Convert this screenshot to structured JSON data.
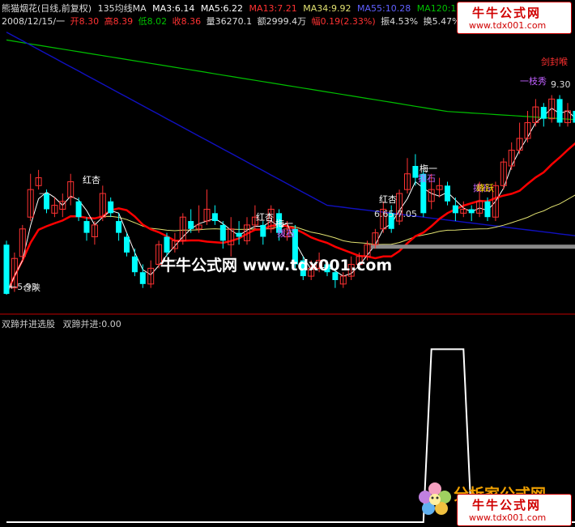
{
  "header": {
    "stock_name": "熊猫烟花(日线,前复权)",
    "ma_label": "135均线MA",
    "ma3": "MA3:6.14",
    "ma5": "MA5:6.22",
    "ma13": "MA13:7.21",
    "ma34": "MA34:9.92",
    "ma55": "MA55:10.28",
    "ma120": "MA120:10.28",
    "arrow_down": "↓"
  },
  "header2": {
    "date": "2008/12/15/一",
    "open": "开8.30",
    "high": "高8.39",
    "low": "低8.02",
    "close": "收8.36",
    "volume": "量36270.1",
    "amount": "额2999.4万",
    "change": "幅0.19(2.33%)",
    "amplitude": "振4.53%",
    "turnover": "换5.47%",
    "float": "流通"
  },
  "sub_panel": {
    "title": "双蹄并进选股",
    "value": "双蹄并进:0.00"
  },
  "watermark": "牛牛公式网 www.tdx001.com",
  "brand": {
    "name": "牛牛公式网",
    "url": "www.tdx001.com"
  },
  "brand_bottom": {
    "name": "牛牛公式网",
    "url": "www.tdx001.com",
    "under": "分析家公式网"
  },
  "annotations": {
    "jianfenghou": "剑封喉",
    "yizhixiu": "一枝秀",
    "price_930": "9.30",
    "hongxing1": "红杏",
    "hongxing2": "红杏",
    "hongxing3": "红杏",
    "meiyi1": "梅一",
    "meiyi2": "梅一",
    "jihua1": "拨石",
    "jihua2": "拨石",
    "jihua3": "拨石",
    "range_label": "6.65-7.05",
    "lowest": "←5.93",
    "yinchang": "仓陕",
    "dash": "—",
    "dash2": "—",
    "huoyao": "峰跃"
  },
  "colors": {
    "up": "#ff3232",
    "down": "#00ffff",
    "ma3": "#ffffff",
    "ma13": "#ff0000",
    "ma34": "#e0e070",
    "ma55": "#1010c0",
    "ma120": "#00c000",
    "sub_line": "#ffffff",
    "divider": "#c00000"
  },
  "chart_data": {
    "type": "candlestick",
    "candles": [
      {
        "o": 7.2,
        "c": 5.95,
        "h": 7.3,
        "l": 5.93
      },
      {
        "o": 6.1,
        "c": 6.85,
        "h": 7.0,
        "l": 6.0
      },
      {
        "o": 6.9,
        "c": 7.6,
        "h": 7.7,
        "l": 6.8
      },
      {
        "o": 7.9,
        "c": 8.6,
        "h": 9.0,
        "l": 7.8
      },
      {
        "o": 8.7,
        "c": 8.9,
        "h": 9.1,
        "l": 8.6
      },
      {
        "o": 8.5,
        "c": 8.1,
        "h": 8.6,
        "l": 8.0
      },
      {
        "o": 8.0,
        "c": 8.2,
        "h": 8.4,
        "l": 7.9
      },
      {
        "o": 8.1,
        "c": 8.3,
        "h": 8.5,
        "l": 7.9
      },
      {
        "o": 8.4,
        "c": 8.8,
        "h": 9.0,
        "l": 8.2
      },
      {
        "o": 8.3,
        "c": 7.9,
        "h": 8.4,
        "l": 7.8
      },
      {
        "o": 7.8,
        "c": 7.5,
        "h": 7.9,
        "l": 7.3
      },
      {
        "o": 7.4,
        "c": 7.7,
        "h": 7.8,
        "l": 7.2
      },
      {
        "o": 7.9,
        "c": 8.5,
        "h": 8.7,
        "l": 7.8
      },
      {
        "o": 8.3,
        "c": 8.0,
        "h": 8.4,
        "l": 7.9
      },
      {
        "o": 7.8,
        "c": 7.5,
        "h": 8.0,
        "l": 7.3
      },
      {
        "o": 7.4,
        "c": 7.0,
        "h": 7.5,
        "l": 6.9
      },
      {
        "o": 6.9,
        "c": 6.5,
        "h": 7.1,
        "l": 6.4
      },
      {
        "o": 6.5,
        "c": 6.2,
        "h": 6.7,
        "l": 6.1
      },
      {
        "o": 6.2,
        "c": 6.6,
        "h": 6.8,
        "l": 6.1
      },
      {
        "o": 6.7,
        "c": 7.2,
        "h": 7.3,
        "l": 6.6
      },
      {
        "o": 7.4,
        "c": 7.0,
        "h": 7.5,
        "l": 6.9
      },
      {
        "o": 7.1,
        "c": 7.3,
        "h": 7.5,
        "l": 7.0
      },
      {
        "o": 7.3,
        "c": 7.9,
        "h": 8.0,
        "l": 7.2
      },
      {
        "o": 7.8,
        "c": 7.6,
        "h": 8.1,
        "l": 7.5
      },
      {
        "o": 7.6,
        "c": 7.7,
        "h": 8.2,
        "l": 7.5
      },
      {
        "o": 7.8,
        "c": 8.1,
        "h": 8.6,
        "l": 7.7
      },
      {
        "o": 8.0,
        "c": 7.8,
        "h": 8.2,
        "l": 7.7
      },
      {
        "o": 7.7,
        "c": 7.3,
        "h": 7.8,
        "l": 7.1
      },
      {
        "o": 7.2,
        "c": 7.6,
        "h": 7.9,
        "l": 6.9
      },
      {
        "o": 7.5,
        "c": 7.4,
        "h": 7.8,
        "l": 7.2
      },
      {
        "o": 7.3,
        "c": 7.7,
        "h": 7.9,
        "l": 7.2
      },
      {
        "o": 7.7,
        "c": 7.9,
        "h": 8.2,
        "l": 7.6
      },
      {
        "o": 7.7,
        "c": 7.4,
        "h": 7.8,
        "l": 7.2
      },
      {
        "o": 7.6,
        "c": 8.1,
        "h": 8.2,
        "l": 7.5
      },
      {
        "o": 8.0,
        "c": 7.5,
        "h": 8.1,
        "l": 7.3
      },
      {
        "o": 7.4,
        "c": 7.6,
        "h": 7.8,
        "l": 7.3
      },
      {
        "o": 7.6,
        "c": 6.7,
        "h": 7.7,
        "l": 6.6
      },
      {
        "o": 6.8,
        "c": 6.4,
        "h": 6.9,
        "l": 6.3
      },
      {
        "o": 6.4,
        "c": 6.6,
        "h": 6.8,
        "l": 6.3
      },
      {
        "o": 6.6,
        "c": 6.8,
        "h": 7.0,
        "l": 6.5
      },
      {
        "o": 6.7,
        "c": 6.5,
        "h": 6.8,
        "l": 6.4
      },
      {
        "o": 6.5,
        "c": 6.3,
        "h": 6.6,
        "l": 6.1
      },
      {
        "o": 6.2,
        "c": 6.4,
        "h": 6.5,
        "l": 6.1
      },
      {
        "o": 6.4,
        "c": 6.7,
        "h": 6.9,
        "l": 6.3
      },
      {
        "o": 6.7,
        "c": 6.9,
        "h": 7.0,
        "l": 6.6
      },
      {
        "o": 6.9,
        "c": 7.2,
        "h": 7.3,
        "l": 6.8
      },
      {
        "o": 7.2,
        "c": 7.5,
        "h": 7.6,
        "l": 7.1
      },
      {
        "o": 7.6,
        "c": 8.1,
        "h": 8.3,
        "l": 7.5
      },
      {
        "o": 8.0,
        "c": 7.6,
        "h": 8.2,
        "l": 7.5
      },
      {
        "o": 7.8,
        "c": 8.5,
        "h": 8.6,
        "l": 7.7
      },
      {
        "o": 8.6,
        "c": 9.0,
        "h": 9.4,
        "l": 8.5
      },
      {
        "o": 9.2,
        "c": 8.9,
        "h": 9.5,
        "l": 8.7
      },
      {
        "o": 9.0,
        "c": 8.0,
        "h": 9.1,
        "l": 7.9
      },
      {
        "o": 8.3,
        "c": 8.6,
        "h": 9.0,
        "l": 8.1
      },
      {
        "o": 8.6,
        "c": 8.7,
        "h": 8.9,
        "l": 8.4
      },
      {
        "o": 8.7,
        "c": 8.3,
        "h": 8.8,
        "l": 8.2
      },
      {
        "o": 8.2,
        "c": 8.0,
        "h": 8.4,
        "l": 7.8
      },
      {
        "o": 8.0,
        "c": 8.1,
        "h": 8.3,
        "l": 7.9
      },
      {
        "o": 8.1,
        "c": 8.0,
        "h": 8.2,
        "l": 7.8
      },
      {
        "o": 8.0,
        "c": 8.3,
        "h": 8.8,
        "l": 7.9
      },
      {
        "o": 8.3,
        "c": 7.9,
        "h": 8.4,
        "l": 7.8
      },
      {
        "o": 7.9,
        "c": 8.7,
        "h": 8.8,
        "l": 7.8
      },
      {
        "o": 8.7,
        "c": 9.3,
        "h": 9.4,
        "l": 8.6
      },
      {
        "o": 9.2,
        "c": 9.6,
        "h": 9.8,
        "l": 9.1
      },
      {
        "o": 9.6,
        "c": 9.9,
        "h": 10.3,
        "l": 9.5
      },
      {
        "o": 9.9,
        "c": 10.3,
        "h": 10.6,
        "l": 9.8
      },
      {
        "o": 10.3,
        "c": 10.7,
        "h": 10.9,
        "l": 10.2
      },
      {
        "o": 10.7,
        "c": 10.4,
        "h": 10.8,
        "l": 10.2
      },
      {
        "o": 10.4,
        "c": 10.9,
        "h": 11.0,
        "l": 10.3
      },
      {
        "o": 10.9,
        "c": 10.3,
        "h": 11.0,
        "l": 10.2
      },
      {
        "o": 10.3,
        "c": 10.6,
        "h": 10.8,
        "l": 10.2
      },
      {
        "o": 10.6,
        "c": 10.3,
        "h": 10.8,
        "l": 10.2
      }
    ],
    "ylim": [
      5.6,
      12.8
    ],
    "sub_series": [
      0,
      0,
      0,
      0,
      0,
      0,
      0,
      0,
      0,
      0,
      0,
      0,
      0,
      0,
      0,
      0,
      0,
      0,
      0,
      0,
      0,
      0,
      0,
      0,
      0,
      0,
      0,
      0,
      0,
      0,
      0,
      0,
      0,
      0,
      0,
      0,
      0,
      0,
      0,
      0,
      0,
      0,
      0,
      0,
      0,
      0,
      0,
      0,
      0,
      0,
      0,
      0,
      0,
      1,
      1,
      1,
      1,
      1,
      0,
      0,
      0,
      0,
      0,
      0,
      0,
      0,
      0,
      0,
      0,
      0,
      0,
      0
    ],
    "sub_ylim": [
      0,
      1.1
    ]
  }
}
